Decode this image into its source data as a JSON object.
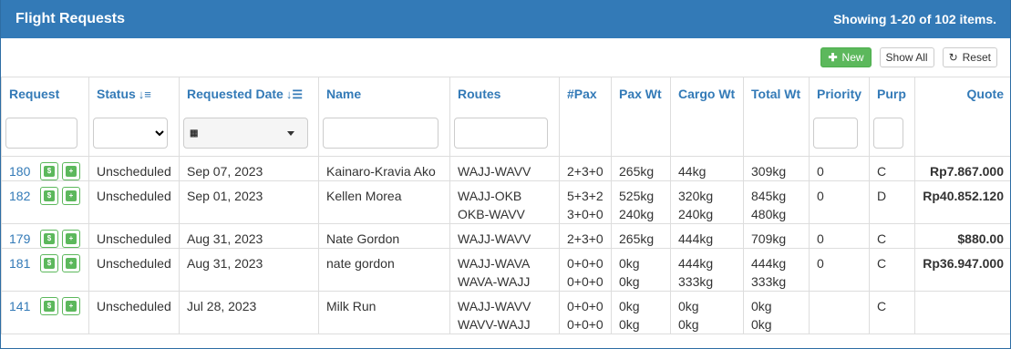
{
  "header": {
    "title": "Flight Requests",
    "summary": "Showing 1-20 of 102 items."
  },
  "toolbar": {
    "new_label": "New",
    "show_all_label": "Show All",
    "reset_label": "Reset"
  },
  "columns": {
    "request": "Request",
    "status": "Status",
    "requested_date": "Requested Date",
    "name": "Name",
    "routes": "Routes",
    "pax": "#Pax",
    "pax_wt": "Pax Wt",
    "cargo_wt": "Cargo Wt",
    "total_wt": "Total Wt",
    "priority": "Priority",
    "purp": "Purp",
    "quote": "Quote"
  },
  "icons": {
    "sort_asc": "sort-numeric-asc-icon",
    "sort_desc": "sort-amount-desc-icon",
    "calendar": "calendar-icon",
    "row_action_1": "file-icon",
    "row_action_2": "calendar-plus-icon"
  },
  "colors": {
    "header_bg": "#337ab7",
    "link": "#337ab7",
    "success": "#5cb85c"
  },
  "rows": [
    {
      "id": "180",
      "status": "Unscheduled",
      "date": "Sep 07, 2023",
      "name": "Kainaro-Kravia Ako",
      "routes": [
        "WAJJ-WAVV"
      ],
      "pax": [
        "2+3+0"
      ],
      "pax_wt": [
        "265kg"
      ],
      "cargo_wt": [
        "44kg"
      ],
      "total_wt": [
        "309kg"
      ],
      "priority": "0",
      "purp": "C",
      "quote": "Rp7.867.000"
    },
    {
      "id": "182",
      "status": "Unscheduled",
      "date": "Sep 01, 2023",
      "name": "Kellen Morea",
      "routes": [
        "WAJJ-OKB",
        "OKB-WAVV"
      ],
      "pax": [
        "5+3+2",
        "3+0+0"
      ],
      "pax_wt": [
        "525kg",
        "240kg"
      ],
      "cargo_wt": [
        "320kg",
        "240kg"
      ],
      "total_wt": [
        "845kg",
        "480kg"
      ],
      "priority": "0",
      "purp": "D",
      "quote": "Rp40.852.120"
    },
    {
      "id": "179",
      "status": "Unscheduled",
      "date": "Aug 31, 2023",
      "name": "Nate Gordon",
      "routes": [
        "WAJJ-WAVV"
      ],
      "pax": [
        "2+3+0"
      ],
      "pax_wt": [
        "265kg"
      ],
      "cargo_wt": [
        "444kg"
      ],
      "total_wt": [
        "709kg"
      ],
      "priority": "0",
      "purp": "C",
      "quote": "$880.00"
    },
    {
      "id": "181",
      "status": "Unscheduled",
      "date": "Aug 31, 2023",
      "name": "nate gordon",
      "routes": [
        "WAJJ-WAVA",
        "WAVA-WAJJ"
      ],
      "pax": [
        "0+0+0",
        "0+0+0"
      ],
      "pax_wt": [
        "0kg",
        "0kg"
      ],
      "cargo_wt": [
        "444kg",
        "333kg"
      ],
      "total_wt": [
        "444kg",
        "333kg"
      ],
      "priority": "0",
      "purp": "C",
      "quote": "Rp36.947.000"
    },
    {
      "id": "141",
      "status": "Unscheduled",
      "date": "Jul 28, 2023",
      "name": "Milk Run",
      "routes": [
        "WAJJ-WAVV",
        "WAVV-WAJJ"
      ],
      "pax": [
        "0+0+0",
        "0+0+0"
      ],
      "pax_wt": [
        "0kg",
        "0kg"
      ],
      "cargo_wt": [
        "0kg",
        "0kg"
      ],
      "total_wt": [
        "0kg",
        "0kg"
      ],
      "priority": "",
      "purp": "C",
      "quote": ""
    }
  ]
}
